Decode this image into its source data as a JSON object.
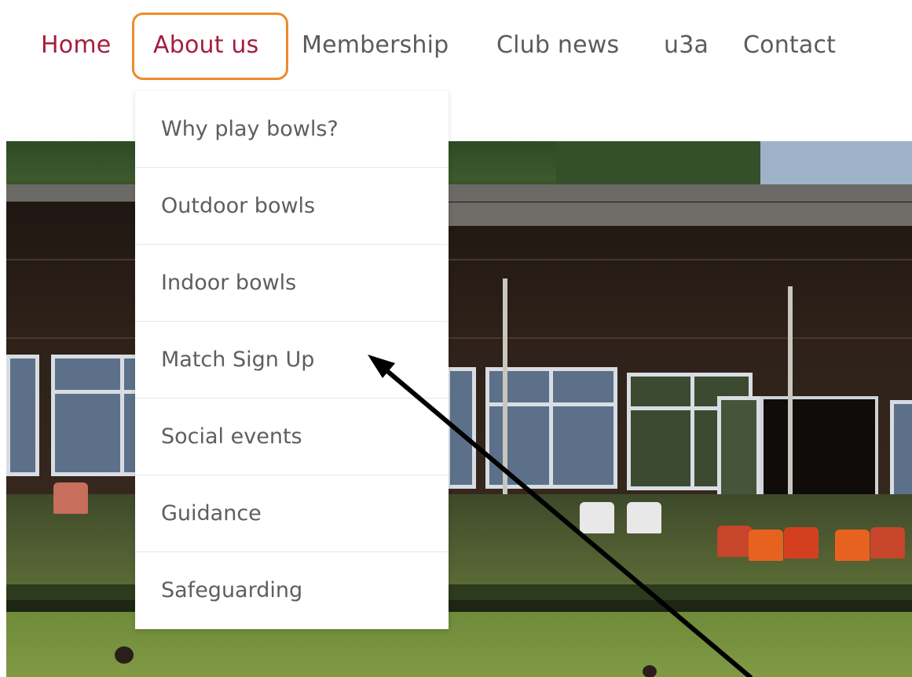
{
  "nav": {
    "items": [
      {
        "label": "Home"
      },
      {
        "label": "About us"
      },
      {
        "label": "Membership"
      },
      {
        "label": "Club news"
      },
      {
        "label": "u3a"
      },
      {
        "label": "Contact"
      }
    ],
    "active": "About us",
    "highlight_color": "#f08a2b",
    "accent_color": "#a51d3f"
  },
  "dropdown": {
    "items": [
      {
        "label": "Why play bowls?"
      },
      {
        "label": "Outdoor bowls"
      },
      {
        "label": "Indoor bowls"
      },
      {
        "label": "Match Sign Up"
      },
      {
        "label": "Social events"
      },
      {
        "label": "Guidance"
      },
      {
        "label": "Safeguarding"
      }
    ]
  },
  "annotation": {
    "arrow_points_to": "Match Sign Up",
    "arrow_color": "#000000"
  },
  "hero": {
    "subject": "bowling-green-clubhouse-photo"
  }
}
